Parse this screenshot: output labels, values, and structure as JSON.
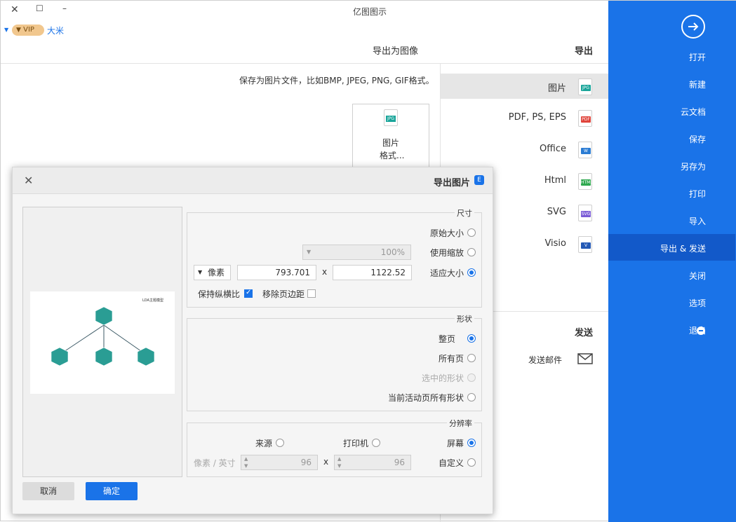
{
  "app": {
    "title": "亿图图示",
    "user": "大米",
    "vip_badge": "VIP",
    "window_controls": [
      "minimize-icon",
      "maximize-icon",
      "close-icon"
    ]
  },
  "sidebar": {
    "items": [
      {
        "label": "打开"
      },
      {
        "label": "新建"
      },
      {
        "label": "云文档"
      },
      {
        "label": "保存"
      },
      {
        "label": "另存为"
      },
      {
        "label": "打印"
      },
      {
        "label": "导入"
      },
      {
        "label": "导出 & 发送",
        "selected": true
      },
      {
        "label": "关闭"
      },
      {
        "label": "选项"
      },
      {
        "label": "退出"
      }
    ]
  },
  "export_panel": {
    "title": "导出",
    "formats": [
      {
        "label": "图片",
        "icon": "JPG",
        "color": "#1aa59a",
        "selected": true
      },
      {
        "label": "PDF, PS, EPS",
        "icon": "PDF",
        "color": "#e0443b"
      },
      {
        "label": "Office",
        "icon": "W",
        "color": "#2b7cd3"
      },
      {
        "label": "Html",
        "icon": "HTML",
        "color": "#2fa84f"
      },
      {
        "label": "SVG",
        "icon": "SVG",
        "color": "#7a5bd6"
      },
      {
        "label": "Visio",
        "icon": "V",
        "color": "#2459b5"
      }
    ],
    "send_title": "发送",
    "send_email": "发送邮件"
  },
  "export_detail": {
    "title": "导出为图像",
    "description": "保存为图片文件，比如BMP, JPEG, PNG, GIF格式。",
    "tile_line1": "图片",
    "tile_line2": "格式...",
    "tile_icon": "JPG"
  },
  "dialog": {
    "title": "导出图片",
    "size_group": {
      "title": "尺寸",
      "original": "原始大小",
      "zoom": "使用缩放",
      "zoom_value": "100%",
      "fit": "适应大小",
      "width": "1122.52",
      "times": "x",
      "height": "793.701",
      "unit": "像素",
      "remove_margin": "移除页边距",
      "keep_ratio": "保持纵横比",
      "remove_margin_checked": false,
      "keep_ratio_checked": true
    },
    "shape_group": {
      "title": "形状",
      "whole_page": "整页",
      "all_pages": "所有页",
      "selected_shapes": "选中的形状",
      "current_page_all": "当前活动页所有形状"
    },
    "resolution_group": {
      "title": "分辨率",
      "screen": "屏幕",
      "printer": "打印机",
      "source": "来源",
      "custom": "自定义",
      "dpi_x": "96",
      "times": "x",
      "dpi_y": "96",
      "unit": "像素 / 英寸"
    },
    "ok": "确定",
    "cancel": "取消",
    "preview": {
      "title": "LDA主题模型",
      "colors": {
        "node": "#2a9d94",
        "line": "#3c5a66"
      }
    }
  }
}
